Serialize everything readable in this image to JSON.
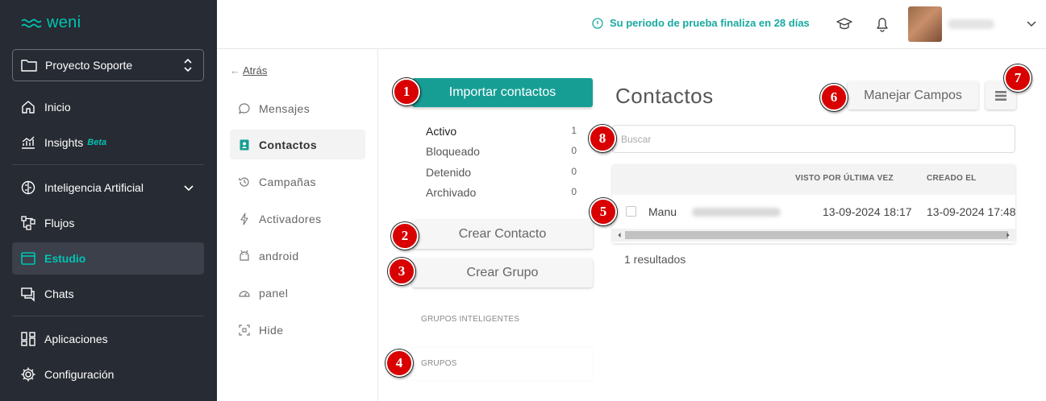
{
  "brand": {
    "name": "weni",
    "accent": "#00c4b3"
  },
  "project": {
    "name": "Proyecto Soporte"
  },
  "sidebar": {
    "items": [
      {
        "label": "Inicio",
        "icon": "home-icon"
      },
      {
        "label": "Insights",
        "badge": "Beta",
        "icon": "insights-chart-icon"
      },
      {
        "label": "Inteligencia Artificial",
        "icon": "brain-icon"
      },
      {
        "label": "Flujos",
        "icon": "flows-icon"
      },
      {
        "label": "Estudio",
        "icon": "studio-window-icon",
        "active": true
      },
      {
        "label": "Chats",
        "icon": "chat-icon"
      },
      {
        "label": "Aplicaciones",
        "icon": "apps-grid-icon"
      },
      {
        "label": "Configuración",
        "icon": "gear-icon"
      }
    ]
  },
  "header": {
    "trial_text": "Su periodo de prueba finaliza en 28 días",
    "trial_color": "#19a9a0"
  },
  "submenu": {
    "back_label": "Atrás",
    "items": [
      {
        "label": "Mensajes",
        "icon": "message-bubble-icon"
      },
      {
        "label": "Contactos",
        "icon": "contact-card-icon",
        "active": true
      },
      {
        "label": "Campañas",
        "icon": "history-icon"
      },
      {
        "label": "Activadores",
        "icon": "bolt-icon"
      },
      {
        "label": "android",
        "icon": "android-icon"
      },
      {
        "label": "panel",
        "icon": "gauge-icon"
      },
      {
        "label": "Hide",
        "icon": "fullscreen-icon"
      }
    ]
  },
  "contacts_sidebar": {
    "import_label": "Importar contactos",
    "statuses": [
      {
        "label": "Activo",
        "count": "1"
      },
      {
        "label": "Bloqueado",
        "count": "0"
      },
      {
        "label": "Detenido",
        "count": "0"
      },
      {
        "label": "Archivado",
        "count": "0"
      }
    ],
    "create_contact_label": "Crear Contacto",
    "create_group_label": "Crear Grupo",
    "smart_groups_label": "GRUPOS INTELIGENTES",
    "groups_label": "GRUPOS"
  },
  "main": {
    "title": "Contactos",
    "manage_fields_label": "Manejar Campos",
    "search_placeholder": "Buscar",
    "columns": [
      "VISTO POR ÚLTIMA VEZ",
      "CREADO EL"
    ],
    "rows": [
      {
        "name": "Manu",
        "last_seen": "13-09-2024 18:17",
        "created": "13-09-2024 17:48"
      }
    ],
    "results_text": "1 resultados"
  },
  "markers": [
    "1",
    "2",
    "3",
    "4",
    "5",
    "6",
    "7",
    "8"
  ],
  "colors": {
    "primary_button": "#169e95",
    "sidebar_bg": "#272b33",
    "marker": "#d80000"
  }
}
